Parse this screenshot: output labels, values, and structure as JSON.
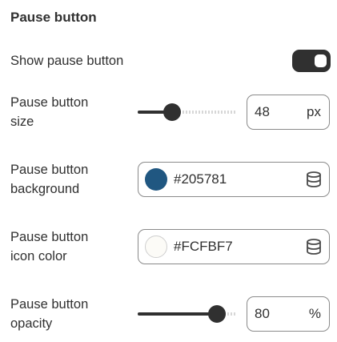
{
  "section": {
    "title": "Pause button"
  },
  "show_pause": {
    "label": "Show pause button",
    "enabled": true
  },
  "size": {
    "label_line1": "Pause button",
    "label_line2": "size",
    "value": "48",
    "unit": "px",
    "slider_percent": 35
  },
  "background": {
    "label_line1": "Pause button",
    "label_line2": "background",
    "value": "#205781",
    "swatch_color": "#205781"
  },
  "icon_color": {
    "label_line1": "Pause button",
    "label_line2": "icon color",
    "value": "#FCFBF7",
    "swatch_color": "#FCFBF7"
  },
  "opacity": {
    "label_line1": "Pause button",
    "label_line2": "opacity",
    "value": "80",
    "unit": "%",
    "slider_percent": 80
  },
  "icons": {
    "toggle": "toggle-switch",
    "color_library": "database-icon"
  }
}
